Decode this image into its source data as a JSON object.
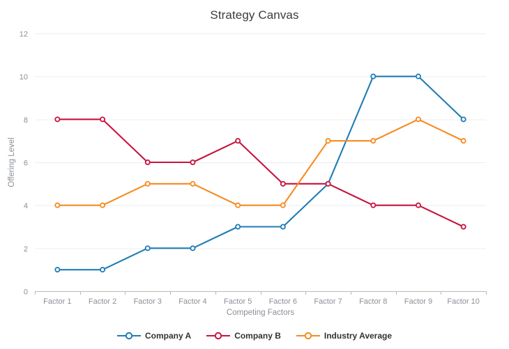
{
  "chart_data": {
    "type": "line",
    "title": "Strategy Canvas",
    "xlabel": "Competing Factors",
    "ylabel": "Offering Level",
    "categories": [
      "Factor 1",
      "Factor 2",
      "Factor 3",
      "Factor 4",
      "Factor 5",
      "Factor 6",
      "Factor 7",
      "Factor 8",
      "Factor 9",
      "Factor 10"
    ],
    "ylim": [
      0,
      12
    ],
    "yticks": [
      0,
      2,
      4,
      6,
      8,
      10,
      12
    ],
    "grid": true,
    "legend_position": "bottom",
    "series": [
      {
        "name": "Company A",
        "color": "#1f7cb4",
        "values": [
          1,
          1,
          2,
          2,
          3,
          3,
          5,
          10,
          10,
          8
        ]
      },
      {
        "name": "Company B",
        "color": "#c8133f",
        "values": [
          8,
          8,
          6,
          6,
          7,
          5,
          5,
          4,
          4,
          3
        ]
      },
      {
        "name": "Industry Average",
        "color": "#f68a1e",
        "values": [
          4,
          4,
          5,
          5,
          4,
          4,
          7,
          7,
          8,
          7
        ]
      }
    ]
  },
  "colors": {
    "grid": "#ececec",
    "axis": "#b9b9b9",
    "tick_text": "#8a8f96",
    "title_text": "#3c3c3c",
    "legend_text": "#333333",
    "background": "#ffffff"
  }
}
